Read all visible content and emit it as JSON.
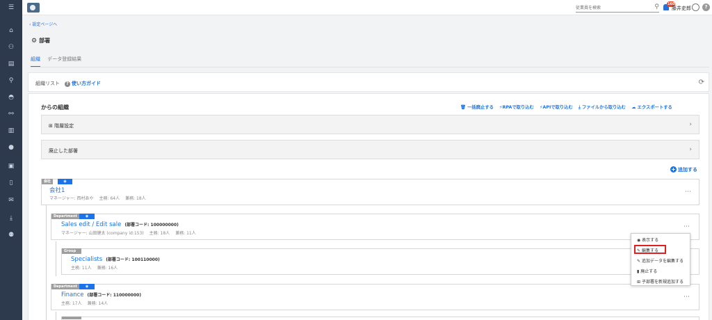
{
  "sidebar": {
    "icons": [
      "menu-icon",
      "home-icon",
      "org-chart-icon",
      "document-icon",
      "search-icon",
      "chat-icon",
      "link-icon",
      "chart-icon",
      "info-icon",
      "contact-card-icon",
      "book-icon",
      "mail-icon",
      "download-icon",
      "user-settings-icon"
    ]
  },
  "topbar": {
    "search_placeholder": "従業員を検索",
    "notification_count": "160",
    "user_name": "藤井史郎",
    "help_label": "?"
  },
  "nav": {
    "back_link": "設定ページへ"
  },
  "page": {
    "title": "部署"
  },
  "tabs": [
    {
      "label": "組織"
    },
    {
      "label": "データ登録結果"
    }
  ],
  "panel": {
    "title": "組織リスト",
    "guide_link": "使い方ガイド"
  },
  "section": {
    "title": "からの組織",
    "actions": [
      {
        "label": "一括廃止する",
        "icon": "trash-icon"
      },
      {
        "label": "RPAで取り込む",
        "icon": "plug-icon"
      },
      {
        "label": "APIで取り込む",
        "icon": "plug-icon"
      },
      {
        "label": "ファイルから取り込む",
        "icon": "download-icon"
      },
      {
        "label": "エクスポートする",
        "icon": "cloud-upload-icon"
      }
    ],
    "hierarchy_label": "階層設定",
    "abolished_label": "廃止した部署",
    "add_label": "追加する"
  },
  "org": {
    "company": {
      "tag": "会社",
      "name": "会社1",
      "manager": "マネージャー: 西村あや",
      "primary": "主務: 64人",
      "secondary": "兼務: 18人"
    },
    "sales": {
      "tag": "Department",
      "name": "Sales edit / Edit sale",
      "code": "(部署コード: 100000000)",
      "manager": "マネージャー: 山田健太 (company id:153)",
      "primary": "主務: 18人",
      "secondary": "兼務: 11人"
    },
    "specialists": {
      "tag": "Group",
      "name": "Specialists",
      "code": "(部署コード: 100110000)",
      "primary": "主務: 11人",
      "secondary": "兼務: 16人"
    },
    "finance": {
      "tag": "Department",
      "name": "Finance",
      "code": "(部署コード: 110000000)",
      "primary": "主務: 17人",
      "secondary": "兼務: 14人"
    }
  },
  "context_menu": {
    "items": [
      {
        "label": "表示する",
        "icon": "eye-icon"
      },
      {
        "label": "編集する",
        "icon": "pencil-icon"
      },
      {
        "label": "追加データを編集する",
        "icon": "pencil-icon"
      },
      {
        "label": "廃止する",
        "icon": "trash-icon"
      },
      {
        "label": "子部署を新規追加する",
        "icon": "plus-square-icon"
      }
    ]
  },
  "colors": {
    "accent": "#1a73e8",
    "sidebar": "#2d3a4e",
    "highlight": "#e02020",
    "badge": "#e8452c"
  }
}
